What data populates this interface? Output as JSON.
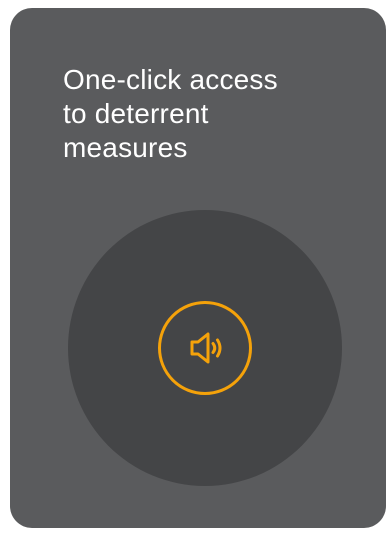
{
  "card": {
    "title": "One-click access\nto deterrent\nmeasures",
    "action_icon": "speaker-volume-icon"
  },
  "colors": {
    "card_background": "#5a5b5d",
    "circle_background": "#444547",
    "accent": "#f5a20a",
    "text": "#ffffff"
  }
}
